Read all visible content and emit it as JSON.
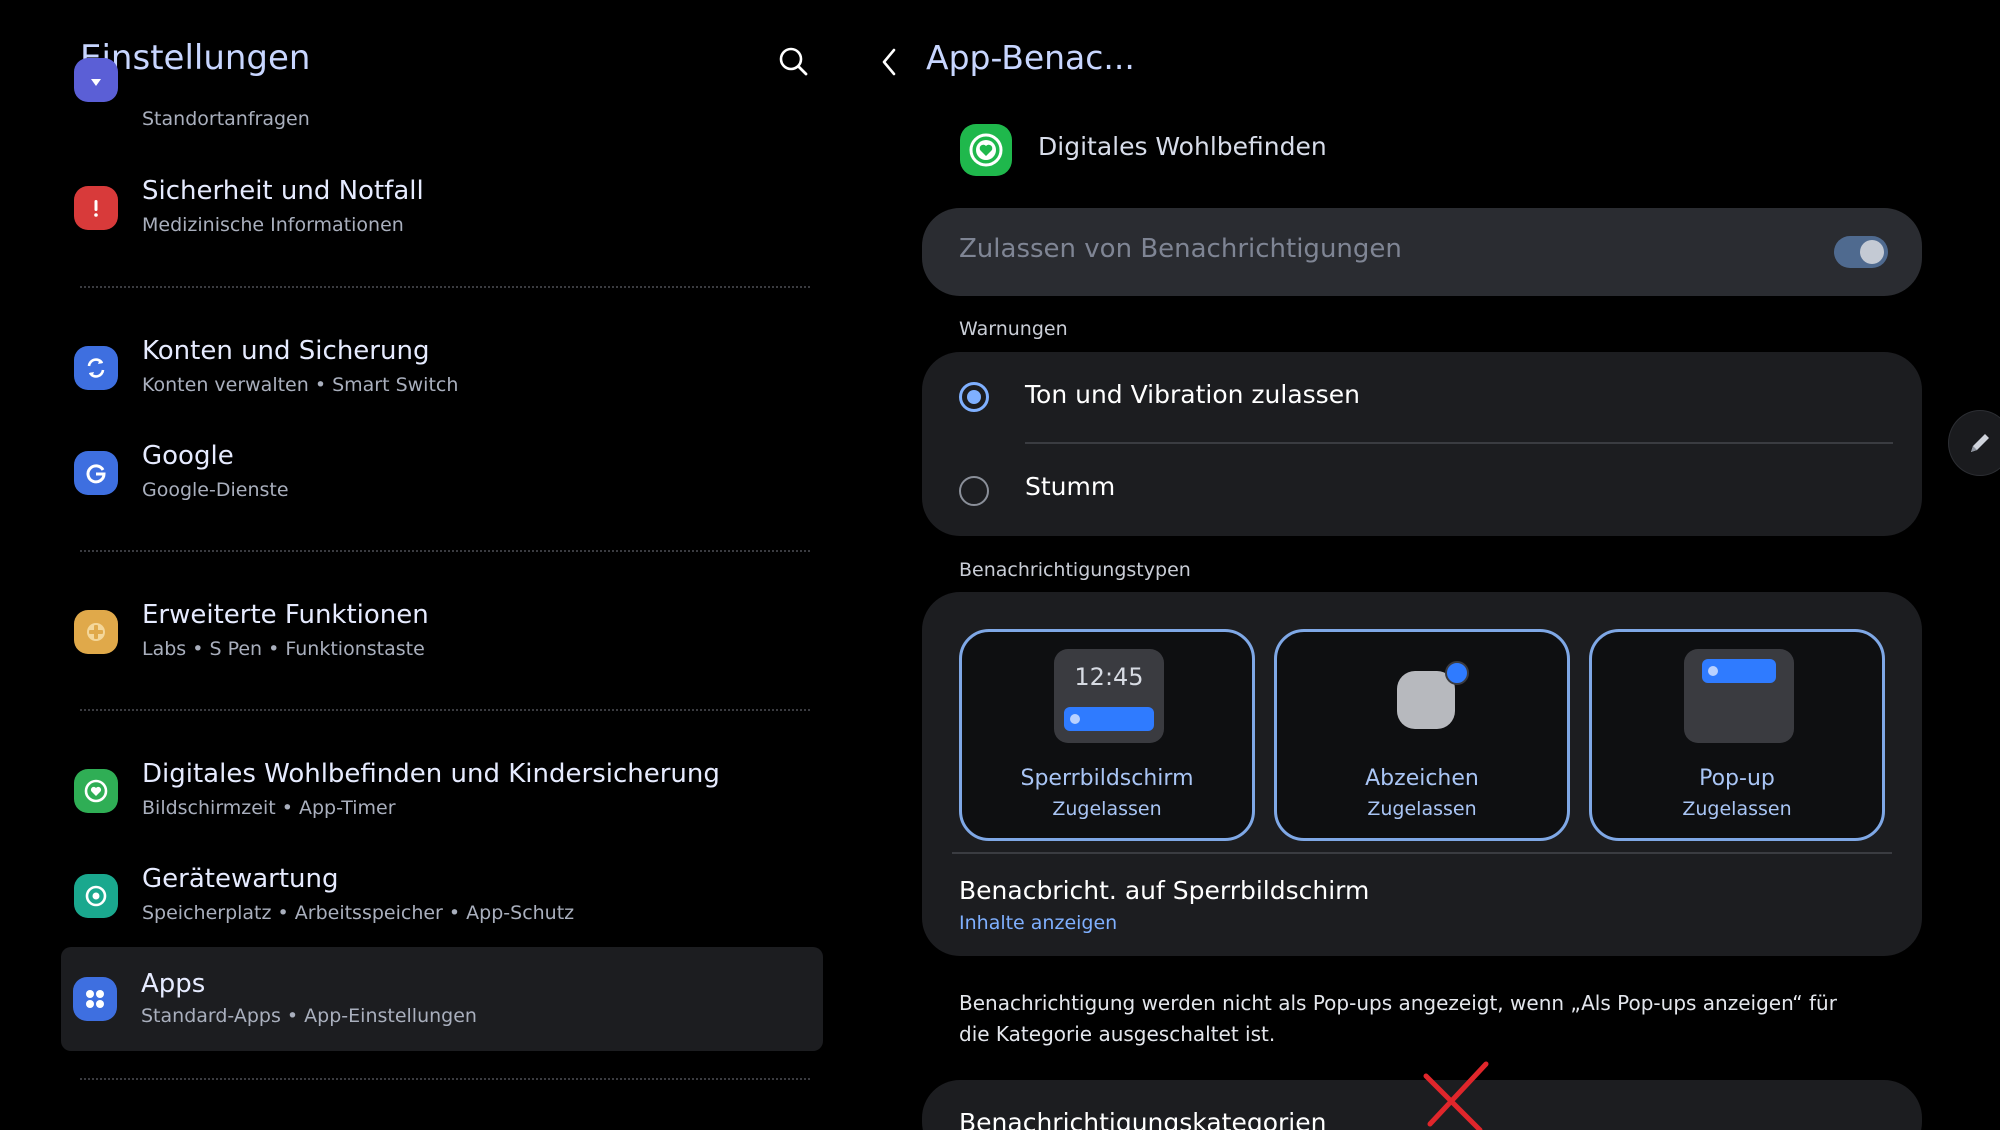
{
  "left": {
    "title": "Einstellungen",
    "items": [
      {
        "title": "",
        "subtitle": "Standortanfragen"
      },
      {
        "title": "Sicherheit und Notfall",
        "subtitle": "Medizinische Informationen"
      },
      {
        "title": "Konten und Sicherung",
        "subtitle": "Konten verwalten • Smart Switch"
      },
      {
        "title": "Google",
        "subtitle": "Google-Dienste"
      },
      {
        "title": "Erweiterte Funktionen",
        "subtitle": "Labs • S Pen • Funktionstaste"
      },
      {
        "title": "Digitales Wohlbefinden und Kindersicherung",
        "subtitle": "Bildschirmzeit • App-Timer"
      },
      {
        "title": "Gerätewartung",
        "subtitle": "Speicherplatz • Arbeitsspeicher • App-Schutz"
      },
      {
        "title": "Apps",
        "subtitle": "Standard-Apps • App-Einstellungen"
      }
    ]
  },
  "right": {
    "title": "App-Benac...",
    "app_name": "Digitales Wohlbefinden",
    "allow_label": "Zulassen von Benachrichtigungen",
    "warnings_label": "Warnungen",
    "option_sound": "Ton und Vibration zulassen",
    "option_mute": "Stumm",
    "types_label": "Benachrichtigungstypen",
    "tiles": [
      {
        "name": "Sperrbildschirm",
        "status": "Zugelassen",
        "preview_time": "12:45"
      },
      {
        "name": "Abzeichen",
        "status": "Zugelassen"
      },
      {
        "name": "Pop-up",
        "status": "Zugelassen"
      }
    ],
    "lock_title": "Benacbricht. auf Sperrbildschirm",
    "lock_sub": "Inhalte anzeigen",
    "note": "Benachrichtigung werden nicht als Pop-ups angezeigt, wenn „Als Pop-ups anzeigen“ für die Kategorie ausgeschaltet ist.",
    "categories_title": "Benachrichtigungskategorien"
  },
  "colors": {
    "accent": "#7fb0ff",
    "tile_border": "#7fa8e6",
    "card_bg": "#1c1d20",
    "annotation_x": "#e0262b"
  },
  "icons": [
    "search-icon",
    "back-chevron-icon",
    "edit-pencil-icon",
    "location-icon",
    "alert-icon",
    "sync-icon",
    "google-icon",
    "plus-puzzle-icon",
    "wellbeing-heart-icon",
    "maintenance-icon",
    "apps-grid-icon"
  ]
}
